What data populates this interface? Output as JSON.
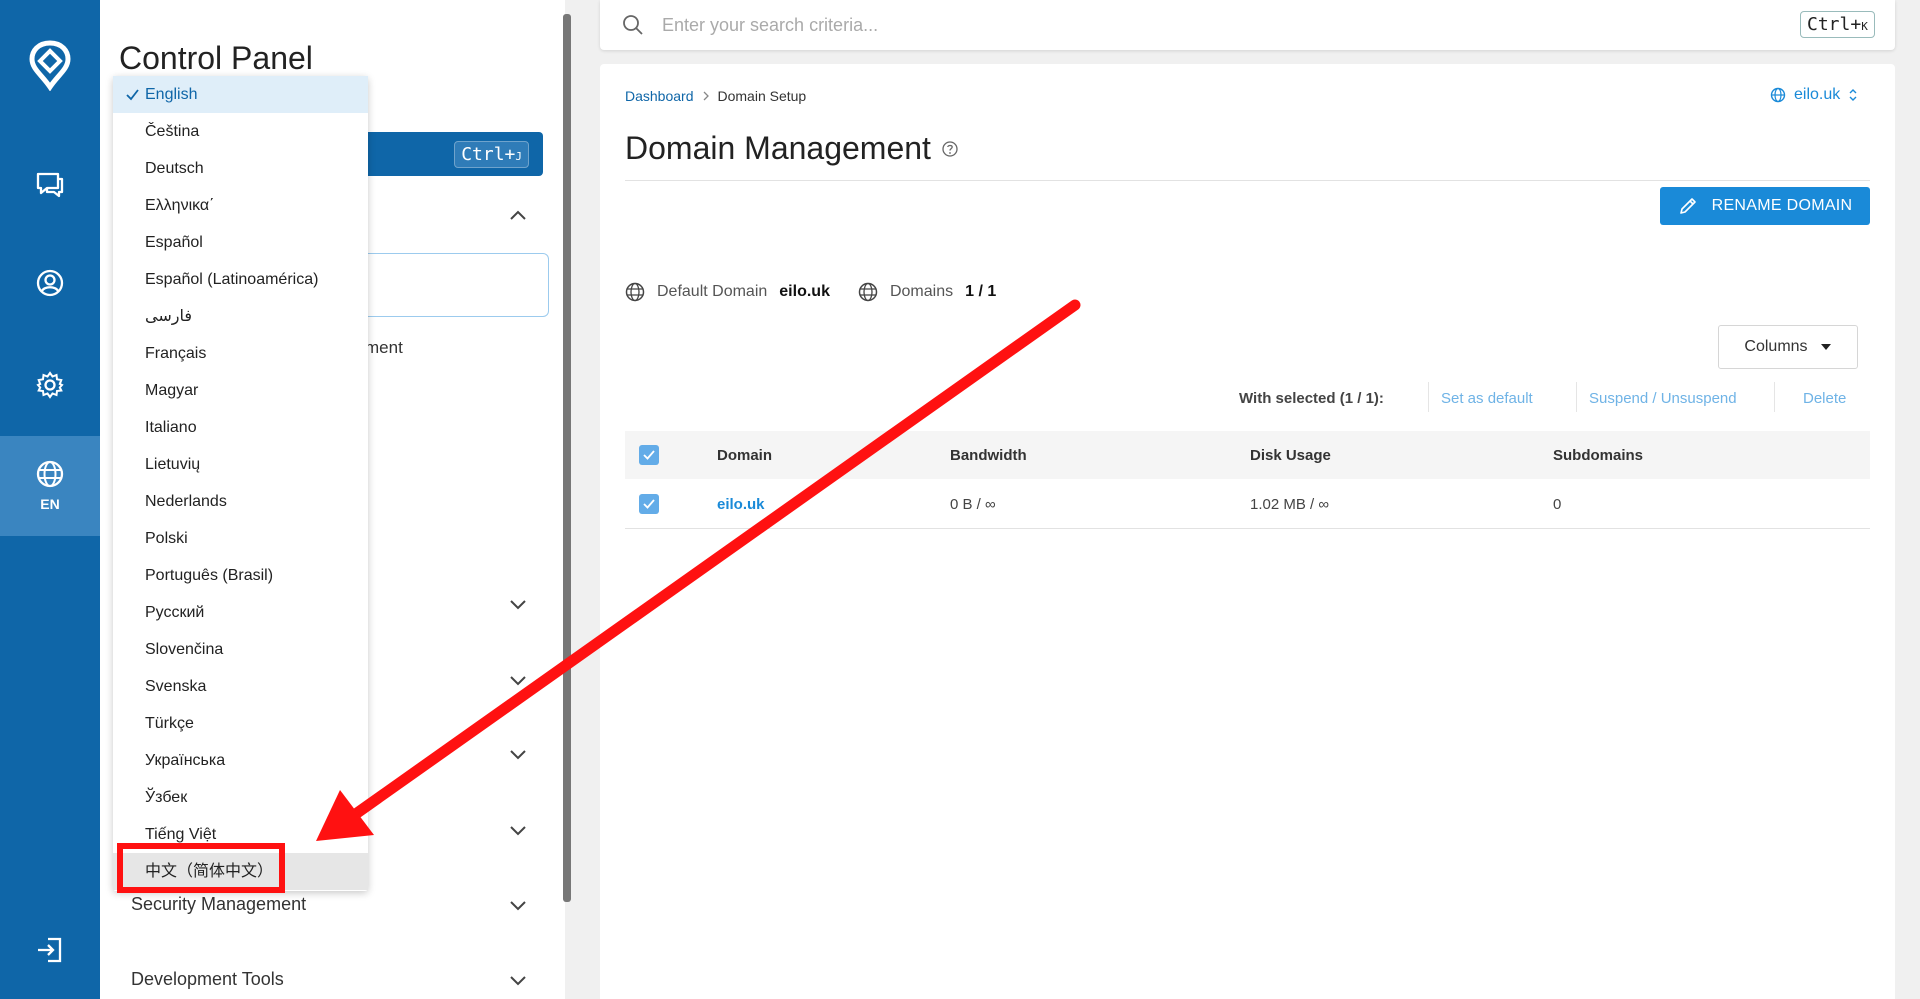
{
  "rail": {
    "language_code": "EN"
  },
  "sidebar": {
    "title": "Control Panel",
    "shortcut_key": "Ctrl+",
    "shortcut_key_small": "J",
    "partial_item_text": "ment",
    "sections": [
      {
        "label": "Security Management"
      },
      {
        "label": "Development Tools"
      }
    ]
  },
  "language_menu": {
    "selected_index": 0,
    "options": [
      "English",
      "Čeština",
      "Deutsch",
      "Ελληνικα΄",
      "Español",
      "Español (Latinoamérica)",
      "فارسی",
      "Français",
      "Magyar",
      "Italiano",
      "Lietuvių",
      "Nederlands",
      "Polski",
      "Português (Brasil)",
      "Русский",
      "Slovenčina",
      "Svenska",
      "Türkçe",
      "Українська",
      "Ўзбек",
      "Tiếng Việt",
      "中文（简体中文）"
    ],
    "highlighted_option": "中文（简体中文）"
  },
  "search": {
    "placeholder": "Enter your search criteria...",
    "shortcut_key": "Ctrl+",
    "shortcut_key_small": "K"
  },
  "breadcrumb": {
    "items": [
      "Dashboard",
      "Domain Setup"
    ]
  },
  "domain_switcher": {
    "current": "eilo.uk"
  },
  "page": {
    "title": "Domain Management",
    "rename_button": "RENAME DOMAIN"
  },
  "stats": {
    "default_domain_label": "Default Domain",
    "default_domain_value": "eilo.uk",
    "domains_label": "Domains",
    "domains_value": "1 / 1"
  },
  "table_controls": {
    "columns_button": "Columns",
    "with_selected": "With selected (1 / 1):",
    "actions": [
      "Set as default",
      "Suspend / Unsuspend",
      "Delete"
    ]
  },
  "table": {
    "headers": [
      "Domain",
      "Bandwidth",
      "Disk Usage",
      "Subdomains"
    ],
    "rows": [
      {
        "domain": "eilo.uk",
        "bandwidth": "0 B / ∞",
        "disk_usage": "1.02 MB / ∞",
        "subdomains": "0"
      }
    ]
  },
  "colors": {
    "brand_blue": "#0f66a8",
    "accent_blue": "#1a8ad8",
    "annotation_red": "#ff1111"
  },
  "icons": {
    "rail": [
      "logo-icon",
      "chat-icon",
      "user-icon",
      "gear-icon",
      "globe-icon",
      "logout-icon"
    ]
  }
}
